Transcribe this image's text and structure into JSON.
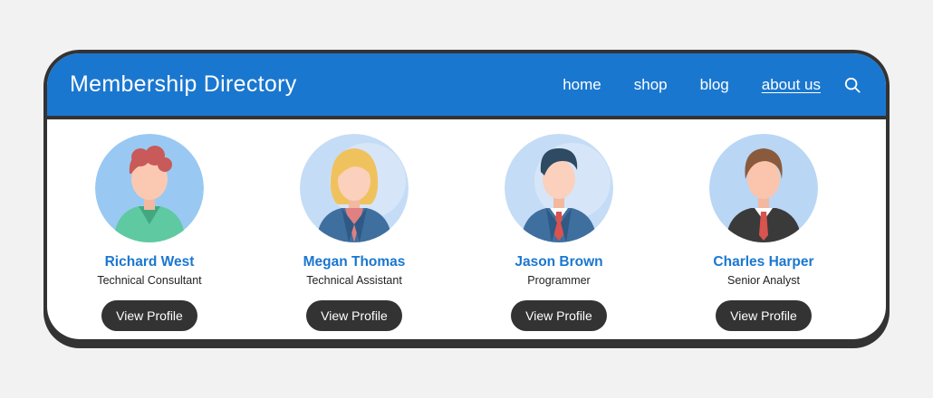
{
  "header": {
    "title": "Membership Directory",
    "nav": [
      {
        "label": "home",
        "active": false
      },
      {
        "label": "shop",
        "active": false
      },
      {
        "label": "blog",
        "active": false
      },
      {
        "label": "about us",
        "active": true
      }
    ],
    "search_icon": "search-icon"
  },
  "members": [
    {
      "name": "Richard West",
      "role": "Technical Consultant",
      "button": "View Profile"
    },
    {
      "name": "Megan Thomas",
      "role": "Technical Assistant",
      "button": "View Profile"
    },
    {
      "name": "Jason Brown",
      "role": "Programmer",
      "button": "View Profile"
    },
    {
      "name": "Charles Harper",
      "role": "Senior Analyst",
      "button": "View Profile"
    }
  ],
  "colors": {
    "accent": "#1a77cf",
    "frame": "#333333",
    "button": "#333333",
    "background": "#f2f2f2"
  }
}
